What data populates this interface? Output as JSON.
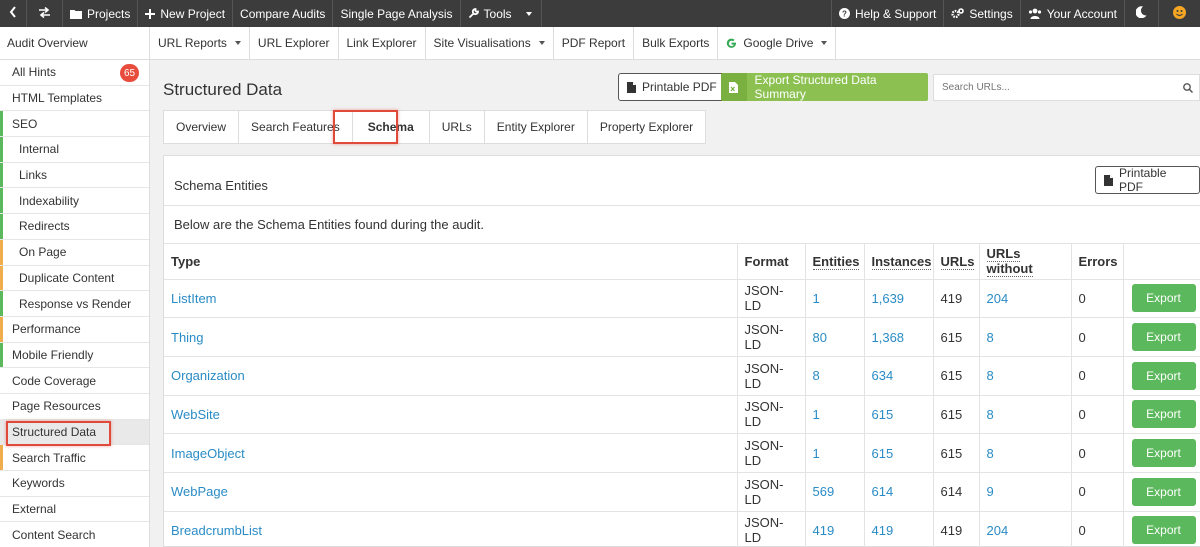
{
  "topbar": {
    "items": [
      {
        "label": "",
        "icon": "chevron-left-icon"
      },
      {
        "label": "",
        "icon": "swap-icon"
      },
      {
        "label": "Projects",
        "icon": "folder-icon"
      },
      {
        "label": "New Project",
        "icon": "plus-icon"
      },
      {
        "label": "Compare Audits"
      },
      {
        "label": "Single Page Analysis"
      },
      {
        "label": "Tools",
        "icon": "wrench-icon",
        "dropdown": true
      }
    ],
    "right": [
      {
        "label": "Help & Support",
        "icon": "question-circle-icon"
      },
      {
        "label": "Settings",
        "icon": "gears-icon"
      },
      {
        "label": "Your Account",
        "icon": "users-icon"
      },
      {
        "label": "",
        "icon": "moon-icon"
      },
      {
        "label": "",
        "icon": "smiley-icon"
      }
    ]
  },
  "subnav": {
    "audit_overview": "Audit Overview",
    "items": [
      {
        "label": "URL Reports",
        "dropdown": true
      },
      {
        "label": "URL Explorer"
      },
      {
        "label": "Link Explorer"
      },
      {
        "label": "Site Visualisations",
        "dropdown": true
      },
      {
        "label": "PDF Report"
      },
      {
        "label": "Bulk Exports"
      },
      {
        "label": "Google Drive",
        "dropdown": true,
        "icon": "google-icon"
      }
    ]
  },
  "sidebar": {
    "items": [
      {
        "label": "All Hints",
        "badge": "65"
      },
      {
        "label": "HTML Templates"
      },
      {
        "label": "SEO",
        "bar": "green"
      },
      {
        "label": "Internal",
        "sub": true,
        "bar": "green"
      },
      {
        "label": "Links",
        "sub": true,
        "bar": "green"
      },
      {
        "label": "Indexability",
        "sub": true,
        "bar": "green"
      },
      {
        "label": "Redirects",
        "sub": true,
        "bar": "green"
      },
      {
        "label": "On Page",
        "sub": true,
        "bar": "orange"
      },
      {
        "label": "Duplicate Content",
        "sub": true,
        "bar": "orange"
      },
      {
        "label": "Response vs Render",
        "sub": true,
        "bar": "green"
      },
      {
        "label": "Performance",
        "bar": "orange"
      },
      {
        "label": "Mobile Friendly",
        "bar": "green"
      },
      {
        "label": "Code Coverage"
      },
      {
        "label": "Page Resources"
      },
      {
        "label": "Structured Data",
        "active": true
      },
      {
        "label": "Search Traffic",
        "bar": "orange"
      },
      {
        "label": "Keywords"
      },
      {
        "label": "External"
      },
      {
        "label": "Content Search"
      }
    ]
  },
  "main": {
    "title": "Structured Data",
    "printable_pdf": "Printable PDF",
    "export_summary": "Export Structured Data Summary",
    "search_placeholder": "Search URLs...",
    "tabs": [
      {
        "label": "Overview"
      },
      {
        "label": "Search Features"
      },
      {
        "label": "Schema",
        "active": true
      },
      {
        "label": "URLs"
      },
      {
        "label": "Entity Explorer"
      },
      {
        "label": "Property Explorer"
      }
    ]
  },
  "panel": {
    "title": "Schema Entities",
    "printable_pdf": "Printable PDF",
    "description": "Below are the Schema Entities found during the audit.",
    "columns": [
      "Type",
      "Format",
      "Entities",
      "Instances",
      "URLs",
      "URLs without",
      "Errors",
      ""
    ],
    "export_label": "Export",
    "rows": [
      {
        "type": "ListItem",
        "format": "JSON-LD",
        "entities": "1",
        "instances": "1,639",
        "urls": "419",
        "urls_without": "204",
        "errors": "0"
      },
      {
        "type": "Thing",
        "format": "JSON-LD",
        "entities": "80",
        "instances": "1,368",
        "urls": "615",
        "urls_without": "8",
        "errors": "0"
      },
      {
        "type": "Organization",
        "format": "JSON-LD",
        "entities": "8",
        "instances": "634",
        "urls": "615",
        "urls_without": "8",
        "errors": "0"
      },
      {
        "type": "WebSite",
        "format": "JSON-LD",
        "entities": "1",
        "instances": "615",
        "urls": "615",
        "urls_without": "8",
        "errors": "0"
      },
      {
        "type": "ImageObject",
        "format": "JSON-LD",
        "entities": "1",
        "instances": "615",
        "urls": "615",
        "urls_without": "8",
        "errors": "0"
      },
      {
        "type": "WebPage",
        "format": "JSON-LD",
        "entities": "569",
        "instances": "614",
        "urls": "614",
        "urls_without": "9",
        "errors": "0"
      },
      {
        "type": "BreadcrumbList",
        "format": "JSON-LD",
        "entities": "419",
        "instances": "419",
        "urls": "419",
        "urls_without": "204",
        "errors": "0"
      }
    ]
  },
  "colors": {
    "accent_link": "#2a8cc6",
    "export_green": "#5cb85c",
    "summary_green": "#8cc152",
    "highlight_red": "#e04a3a",
    "topbar": "#3c3c3c"
  }
}
